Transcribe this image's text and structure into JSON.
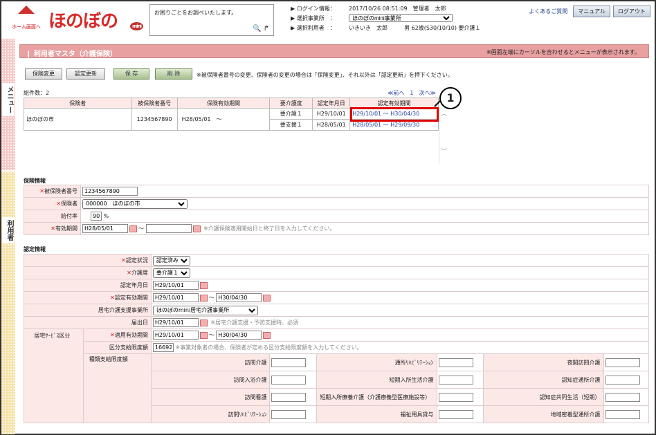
{
  "header": {
    "home_label": "ホーム画面へ",
    "brand_text": "ほのぼの",
    "brand_mini": "mini",
    "help_text": "お困りごとをお調べいたします。",
    "login_label": "ログイン情報：",
    "login_value": "2017/10/26 08:51:09　管理者　太郎",
    "office_label": "選択事業所　：",
    "office_value": "ほのぼのmini事業所",
    "user_label": "選択利用者　：",
    "user_value": "いきいき　太郎　　　男 62歳(S30/10/10) 要介護１",
    "faq": "よくあるご質問",
    "manual": "マニュアル",
    "logout": "ログアウト"
  },
  "side": {
    "menu": "メニュー",
    "user": "利用者"
  },
  "title": {
    "text": "利用者マスタ（介護保険）",
    "note": "※画面左端にカーソルを合わせるとメニューが表示されます。"
  },
  "buttons": {
    "hoken_henko": "保険変更",
    "nintei_koshin": "認定更新",
    "save": "保 存",
    "delete": "削 除",
    "note": "※被保険者番号の変更、保険者の変更の場合は「保険変更」、それ以外は「認定更新」を押下ください。"
  },
  "list": {
    "total": "総件数：2",
    "pager": "≪前へ　1　次へ≫",
    "headers": [
      "保険者",
      "被保険者番号",
      "保険有効期間",
      "要介護度",
      "認定年月日",
      "認定有効期間"
    ],
    "row": {
      "insurer": "ほのぼの市",
      "number": "1234567890",
      "period": "H28/05/01　〜"
    },
    "sub": [
      {
        "level": "要介護１",
        "date": "H29/10/01",
        "valid": "H29/10/01 〜 H30/04/30"
      },
      {
        "level": "要支援１",
        "date": "H28/05/01",
        "valid": "H28/05/01 〜 H29/09/30"
      }
    ],
    "callout": "1"
  },
  "hoken": {
    "title": "保険情報",
    "number_label": "被保険者番号",
    "number_value": "1234567890",
    "insurer_label": "保険者",
    "insurer_value": "000000　ほのぼの市",
    "rate_label": "給付率",
    "rate_value": "90",
    "rate_unit": "%",
    "period_label": "有効期間",
    "period_from": "H28/05/01",
    "period_note": "※介護保険適用開始日と終了日を入力してください。"
  },
  "nintei": {
    "title": "認定情報",
    "status_label": "認定状況",
    "status_value": "認定済み",
    "level_label": "介護度",
    "level_value": "要介護１",
    "date_label": "認定年月日",
    "date_value": "H29/10/01",
    "valid_label": "認定有効期間",
    "valid_from": "H29/10/01",
    "valid_to": "H30/04/30",
    "office_label": "居宅介護支援事業所",
    "office_value": "ほのぼのmini居宅介護事業所",
    "notify_label": "届出日",
    "notify_value": "H29/10/01",
    "notify_note": "※居宅介護支援・予防支援時、必須",
    "kubun_label": "居宅ｻｰﾋﾞｽ区分",
    "apply_label": "適用有効期間",
    "apply_from": "H29/10/01",
    "apply_to": "H30/04/30",
    "limit_label": "区分支給限度額",
    "limit_value": "16692",
    "limit_note": "※事業対象者の場合、保険者が定める区分支給限度額を入力してください。",
    "type_label": "種類支給限度額",
    "services": [
      [
        "訪問介護",
        "通所ﾘﾊﾋﾞﾘﾃｰｼｮﾝ",
        "夜間訪問介護"
      ],
      [
        "訪問入浴介護",
        "短期入所生活介護",
        "認知症通所介護"
      ],
      [
        "訪問看護",
        "短期入所療養介護（介護療養型医療施設等）",
        "認知症共同生活（短期）"
      ],
      [
        "訪問ﾘﾊﾋﾞﾘﾃｰｼｮﾝ",
        "福祉用具貸与",
        "地域密着型通所介護"
      ]
    ]
  },
  "marks": {
    "required": "✕",
    "tilde": "〜"
  }
}
